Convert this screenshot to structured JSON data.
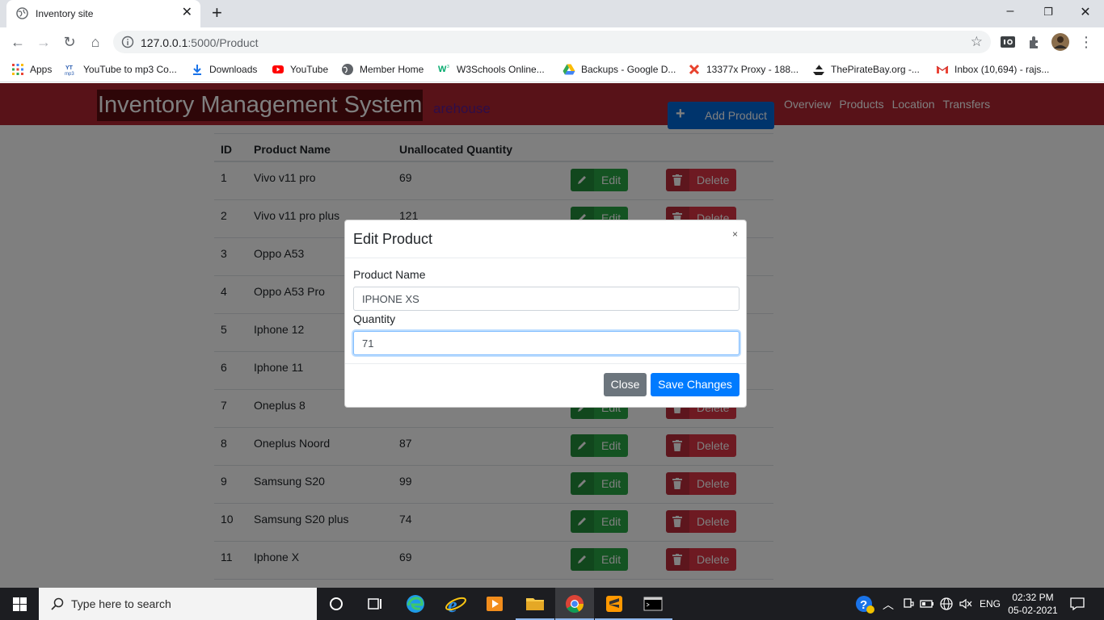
{
  "browser": {
    "tab_title": "Inventory site",
    "url_host": "127.0.0.1",
    "url_rest": ":5000/Product",
    "bookmarks": [
      {
        "label": "Apps",
        "icon": "apps-grid-icon"
      },
      {
        "label": "YouTube to mp3 Co...",
        "icon": "yt-mp3-icon"
      },
      {
        "label": "Downloads",
        "icon": "download-icon"
      },
      {
        "label": "YouTube",
        "icon": "youtube-icon"
      },
      {
        "label": "Member Home",
        "icon": "globe-icon"
      },
      {
        "label": "W3Schools Online...",
        "icon": "w3schools-icon"
      },
      {
        "label": "Backups - Google D...",
        "icon": "google-drive-icon"
      },
      {
        "label": "13377x Proxy - 188...",
        "icon": "x-icon"
      },
      {
        "label": "ThePirateBay.org -...",
        "icon": "pirate-ship-icon"
      },
      {
        "label": "Inbox (10,694) - rajs...",
        "icon": "gmail-icon"
      }
    ]
  },
  "navbar": {
    "brand": "Inventory Management System",
    "brand_sub": "arehouse",
    "add_button": "Add Product",
    "links": [
      "Overview",
      "Products",
      "Location",
      "Transfers"
    ]
  },
  "table": {
    "headers": {
      "id": "ID",
      "name": "Product Name",
      "qty": "Unallocated Quantity"
    },
    "edit_label": "Edit",
    "delete_label": "Delete",
    "rows": [
      {
        "id": "1",
        "name": "Vivo v11 pro",
        "qty": "69"
      },
      {
        "id": "2",
        "name": "Vivo v11 pro plus",
        "qty": "121"
      },
      {
        "id": "3",
        "name": "Oppo A53",
        "qty": ""
      },
      {
        "id": "4",
        "name": "Oppo A53 Pro",
        "qty": ""
      },
      {
        "id": "5",
        "name": "Iphone 12",
        "qty": ""
      },
      {
        "id": "6",
        "name": "Iphone 11",
        "qty": ""
      },
      {
        "id": "7",
        "name": "Oneplus 8",
        "qty": ""
      },
      {
        "id": "8",
        "name": "Oneplus Noord",
        "qty": "87"
      },
      {
        "id": "9",
        "name": "Samsung S20",
        "qty": "99"
      },
      {
        "id": "10",
        "name": "Samsung S20 plus",
        "qty": "74"
      },
      {
        "id": "11",
        "name": "Iphone X",
        "qty": "69"
      }
    ]
  },
  "modal": {
    "title": "Edit Product",
    "close_x": "×",
    "name_label": "Product Name",
    "name_value": "IPHONE XS",
    "qty_label": "Quantity",
    "qty_value": "71",
    "close_button": "Close",
    "save_button": "Save Changes"
  },
  "taskbar": {
    "search_placeholder": "Type here to search",
    "lang": "ENG",
    "time": "02:32 PM",
    "date": "05-02-2021"
  },
  "colors": {
    "navbar": "#b02530",
    "brand_bg": "#5c0d11",
    "edit": "#28a745",
    "delete": "#dc3545",
    "primary": "#007bff",
    "secondary": "#6c757d"
  }
}
